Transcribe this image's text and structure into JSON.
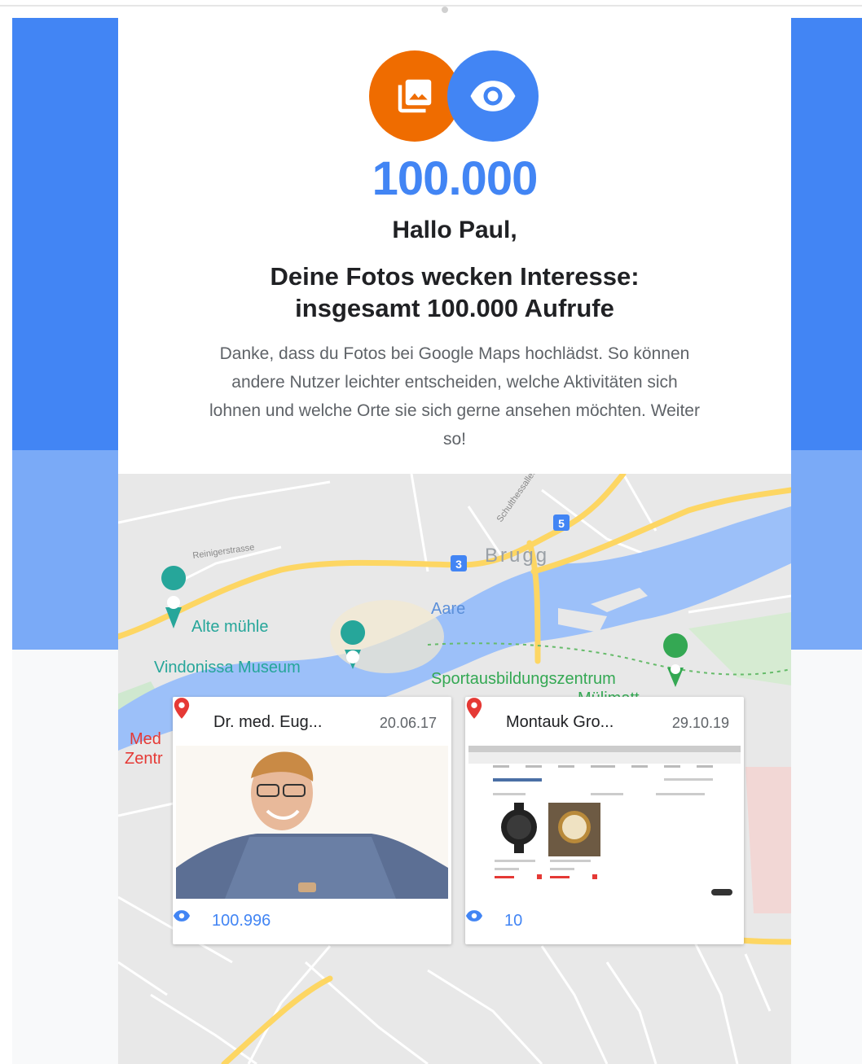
{
  "stats": {
    "views_number": "100.000"
  },
  "message": {
    "greeting": "Hallo Paul,",
    "headline_line1": "Deine Fotos wecken Interesse:",
    "headline_line2": "insgesamt 100.000 Aufrufe",
    "body": "Danke, dass du Fotos bei Google Maps hochlädst. So können andere Nutzer leichter entscheiden, welche Aktivitäten sich lohnen und welche Orte sie sich gerne ansehen möchten. Weiter so!"
  },
  "map": {
    "city_label": "Brugg",
    "river_label": "Aare",
    "route_badge_1": "5",
    "route_badge_2": "3",
    "street_label_1": "Schulthessallee",
    "street_label_2": "Reinigerstrasse",
    "poi": [
      {
        "label": "Alte mühle",
        "color": "#26a69a"
      },
      {
        "label": "Vindonissa Museum",
        "color": "#26a69a"
      },
      {
        "label": "Sportausbildungszentrum",
        "color": "#34a853"
      },
      {
        "label": "Mülimatt",
        "color": "#34a853"
      },
      {
        "label": "Med",
        "color": "#e53935"
      },
      {
        "label": "Zentr",
        "color": "#e53935"
      }
    ]
  },
  "places": [
    {
      "name": "Dr. med. Eug...",
      "date": "20.06.17",
      "views": "100.996",
      "icon": "location-pin-icon"
    },
    {
      "name": "Montauk Gro...",
      "date": "29.10.19",
      "views": "10",
      "icon": "location-pin-icon"
    }
  ],
  "colors": {
    "primary_blue": "#4285f4",
    "light_blue": "#7aaaf7",
    "orange": "#ef6c00",
    "pin_red": "#e53935",
    "text_dark": "#202124",
    "text_grey": "#5f6368"
  },
  "icons": {
    "photos": "photo-library-icon",
    "views": "eye-icon"
  }
}
